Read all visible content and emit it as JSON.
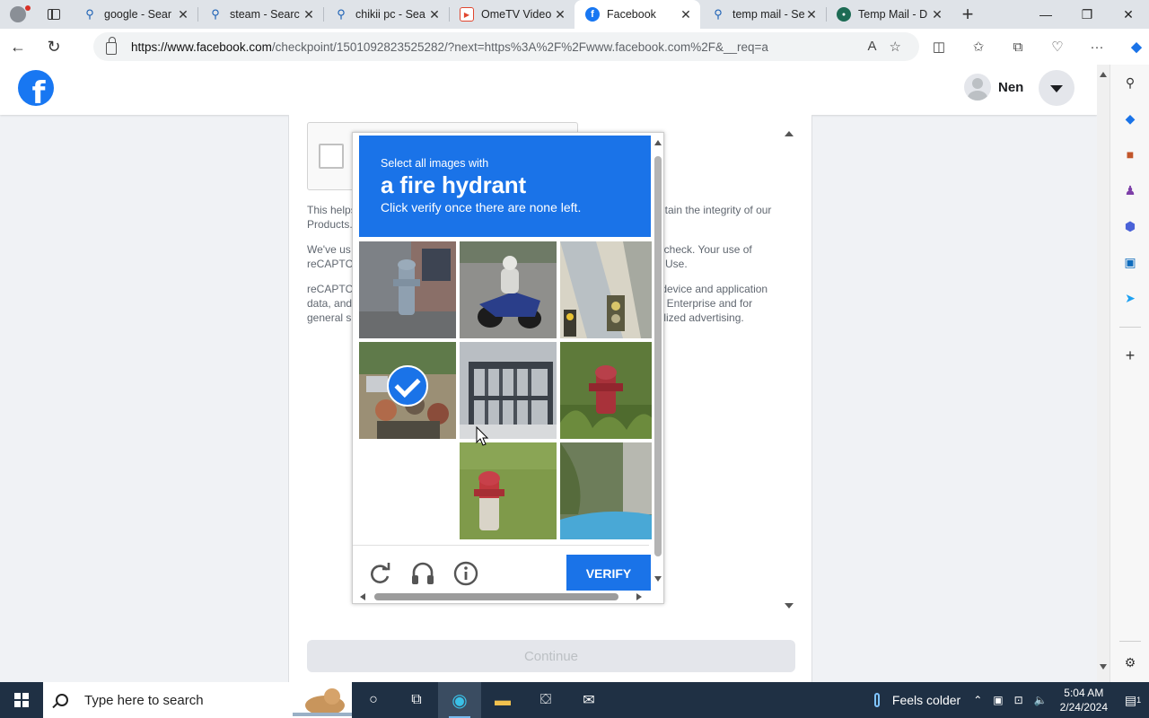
{
  "browser": {
    "tabs": [
      {
        "title": "google - Sear",
        "icon": "search-icon",
        "active": false
      },
      {
        "title": "steam - Searc",
        "icon": "search-icon",
        "active": false
      },
      {
        "title": "chikii pc - Sea",
        "icon": "search-icon",
        "active": false
      },
      {
        "title": "OmeTV Video",
        "icon": "ometv-icon",
        "active": false
      },
      {
        "title": "Facebook",
        "icon": "facebook-icon",
        "active": true
      },
      {
        "title": "temp mail - Se",
        "icon": "search-icon",
        "active": false
      },
      {
        "title": "Temp Mail - D",
        "icon": "tempmail-icon",
        "active": false
      }
    ],
    "url_domain": "https://www.facebook.com",
    "url_path": "/checkpoint/1501092823525282/?next=https%3A%2F%2Fwww.facebook.com%2F&__req=a"
  },
  "facebook": {
    "logo_letter": "f",
    "user_name": "Nen",
    "paragraphs": [
      "This helps ... ntain the integrity of our Products.",
      "We've us... ty check. Your use of reCAPTC... Use.",
      "reCAPTC... s device and application data, and ... A Enterprise and for general s... nalized advertising."
    ],
    "para1_left": "This helps",
    "para1_left2": "Products.",
    "para1_right": "ntain the integrity of our",
    "para2_left": "We've us",
    "para2_left2": "reCAPTC",
    "para2_right": "ty check. Your use of",
    "para2_right2": "Use.",
    "para3_left": "reCAPTC",
    "para3_left2": "data, and",
    "para3_left3": "general s",
    "para3_right": "s device and application",
    "para3_right2": "A Enterprise and for",
    "para3_right3": "nalized advertising.",
    "continue_label": "Continue"
  },
  "captcha": {
    "instruction": "Select all images with",
    "target": "a fire hydrant",
    "subtext": "Click verify once there are none left.",
    "verify_label": "VERIFY",
    "tiles": [
      {
        "content": "fire hydrant by wall",
        "selected": false
      },
      {
        "content": "motorcycle on road",
        "selected": false
      },
      {
        "content": "traffic light",
        "selected": false
      },
      {
        "content": "crowd of motorcyclists",
        "selected": true
      },
      {
        "content": "balcony railing",
        "selected": false
      },
      {
        "content": "red fire hydrant in grass",
        "selected": false
      },
      {
        "content": "blank (loading)",
        "selected": false
      },
      {
        "content": "red fire hydrant on lawn",
        "selected": false
      },
      {
        "content": "car roof and plants",
        "selected": false
      }
    ],
    "icons": [
      "reload-icon",
      "audio-icon",
      "info-icon"
    ]
  },
  "taskbar": {
    "search_placeholder": "Type here to search",
    "weather": "Feels colder",
    "time": "5:04 AM",
    "date": "2/24/2024",
    "notification_count": "1"
  },
  "colors": {
    "facebook_blue": "#1877f2",
    "captcha_blue": "#1a73e8",
    "taskbar": "#1f3044"
  }
}
